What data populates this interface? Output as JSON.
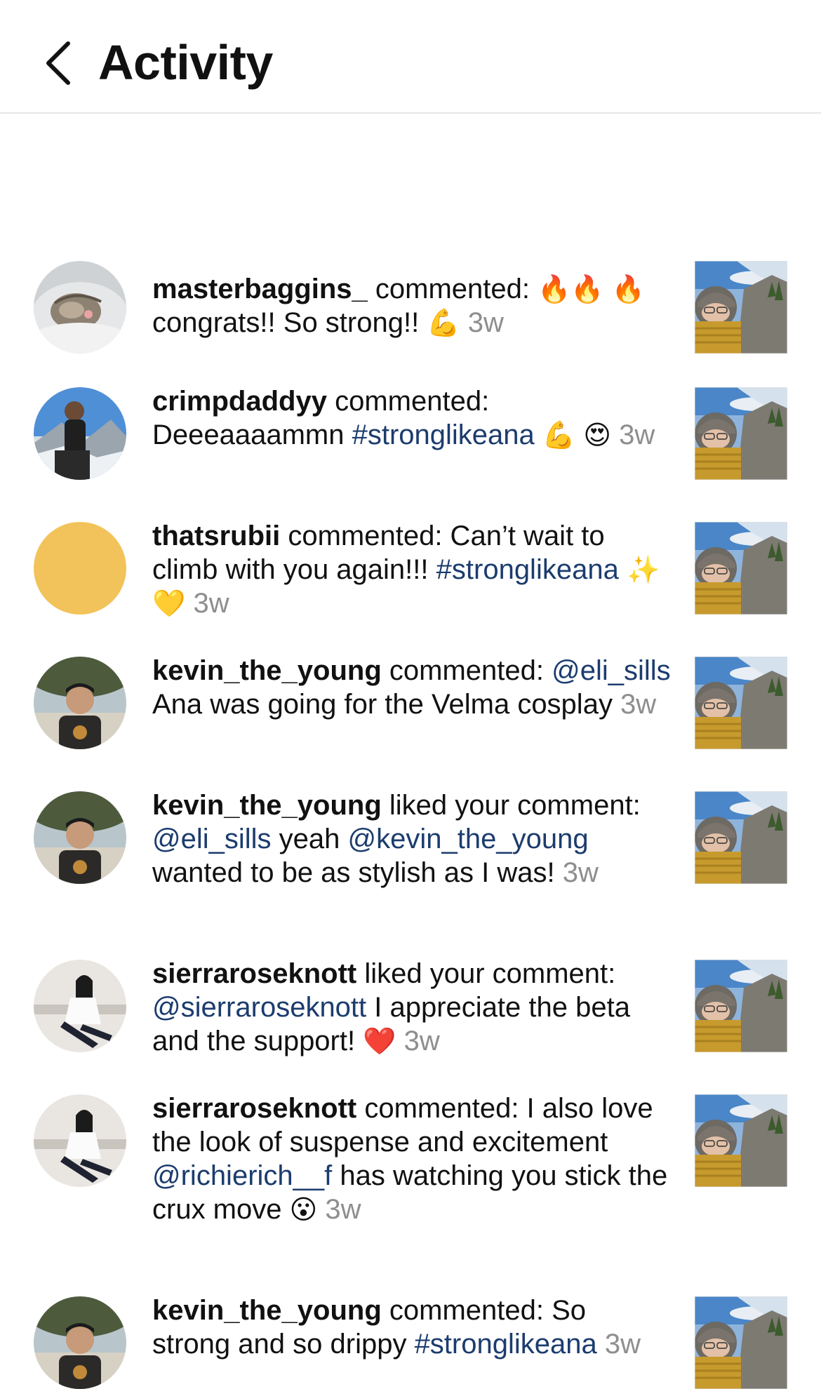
{
  "header": {
    "title": "Activity"
  },
  "items": [
    {
      "avatar": "cat",
      "parts": [
        {
          "t": "user",
          "v": "masterbaggins_"
        },
        {
          "t": "text",
          "v": " commented: "
        },
        {
          "t": "emoji",
          "v": "🔥🔥"
        },
        {
          "t": "text",
          "v": " "
        },
        {
          "t": "emoji",
          "v": "🔥"
        },
        {
          "t": "text",
          "v": " congrats!! So strong!! "
        },
        {
          "t": "emoji",
          "v": "💪"
        },
        {
          "t": "time",
          "v": " 3w"
        }
      ]
    },
    {
      "avatar": "climber",
      "parts": [
        {
          "t": "user",
          "v": "crimpdaddyy"
        },
        {
          "t": "text",
          "v": " commented: Deeeaaaammn "
        },
        {
          "t": "link",
          "v": "#stronglikeana"
        },
        {
          "t": "text",
          "v": " "
        },
        {
          "t": "emoji",
          "v": "💪"
        },
        {
          "t": "text",
          "v": " "
        },
        {
          "t": "emoji",
          "v": "😍"
        },
        {
          "t": "time",
          "v": " 3w"
        }
      ]
    },
    {
      "avatar": "yellow",
      "parts": [
        {
          "t": "user",
          "v": "thatsrubii"
        },
        {
          "t": "text",
          "v": " commented: Can’t wait to climb with you again!!! "
        },
        {
          "t": "link",
          "v": "#stronglikeana"
        },
        {
          "t": "text",
          "v": " "
        },
        {
          "t": "emoji",
          "v": "✨💛"
        },
        {
          "t": "time",
          "v": " 3w"
        }
      ]
    },
    {
      "avatar": "man",
      "parts": [
        {
          "t": "user",
          "v": "kevin_the_young"
        },
        {
          "t": "text",
          "v": " commented: "
        },
        {
          "t": "link",
          "v": "@eli_sills"
        },
        {
          "t": "text",
          "v": " Ana was going for the Velma cosplay"
        },
        {
          "t": "time",
          "v": " 3w"
        }
      ]
    },
    {
      "avatar": "man",
      "parts": [
        {
          "t": "user",
          "v": "kevin_the_young"
        },
        {
          "t": "text",
          "v": " liked your comment: "
        },
        {
          "t": "link",
          "v": "@eli_sills"
        },
        {
          "t": "text",
          "v": " yeah "
        },
        {
          "t": "link",
          "v": "@kevin_the_young"
        },
        {
          "t": "text",
          "v": " wanted to be as stylish as I was!"
        },
        {
          "t": "time",
          "v": " 3w"
        }
      ]
    },
    {
      "avatar": "woman",
      "parts": [
        {
          "t": "user",
          "v": "sierraroseknott"
        },
        {
          "t": "text",
          "v": " liked your comment: "
        },
        {
          "t": "link",
          "v": "@sierraroseknott"
        },
        {
          "t": "text",
          "v": " I appreciate the beta and the support! "
        },
        {
          "t": "emoji",
          "v": "❤️"
        },
        {
          "t": "time",
          "v": " 3w"
        }
      ]
    },
    {
      "avatar": "woman",
      "parts": [
        {
          "t": "user",
          "v": "sierraroseknott"
        },
        {
          "t": "text",
          "v": " commented: I also love the look of suspense and excitement "
        },
        {
          "t": "link",
          "v": "@richierich__f"
        },
        {
          "t": "text",
          "v": " has watching you stick the crux move "
        },
        {
          "t": "emoji",
          "v": "😮"
        },
        {
          "t": "time",
          "v": " 3w"
        }
      ]
    },
    {
      "avatar": "man",
      "parts": [
        {
          "t": "user",
          "v": "kevin_the_young"
        },
        {
          "t": "text",
          "v": " commented: So strong and so drippy "
        },
        {
          "t": "link",
          "v": "#stronglikeana"
        },
        {
          "t": "time",
          "v": " 3w"
        }
      ]
    }
  ],
  "colors": {
    "link": "#1c3c6e",
    "time": "#8e8e8e",
    "placeholder_avatar": "#f2c35a"
  }
}
